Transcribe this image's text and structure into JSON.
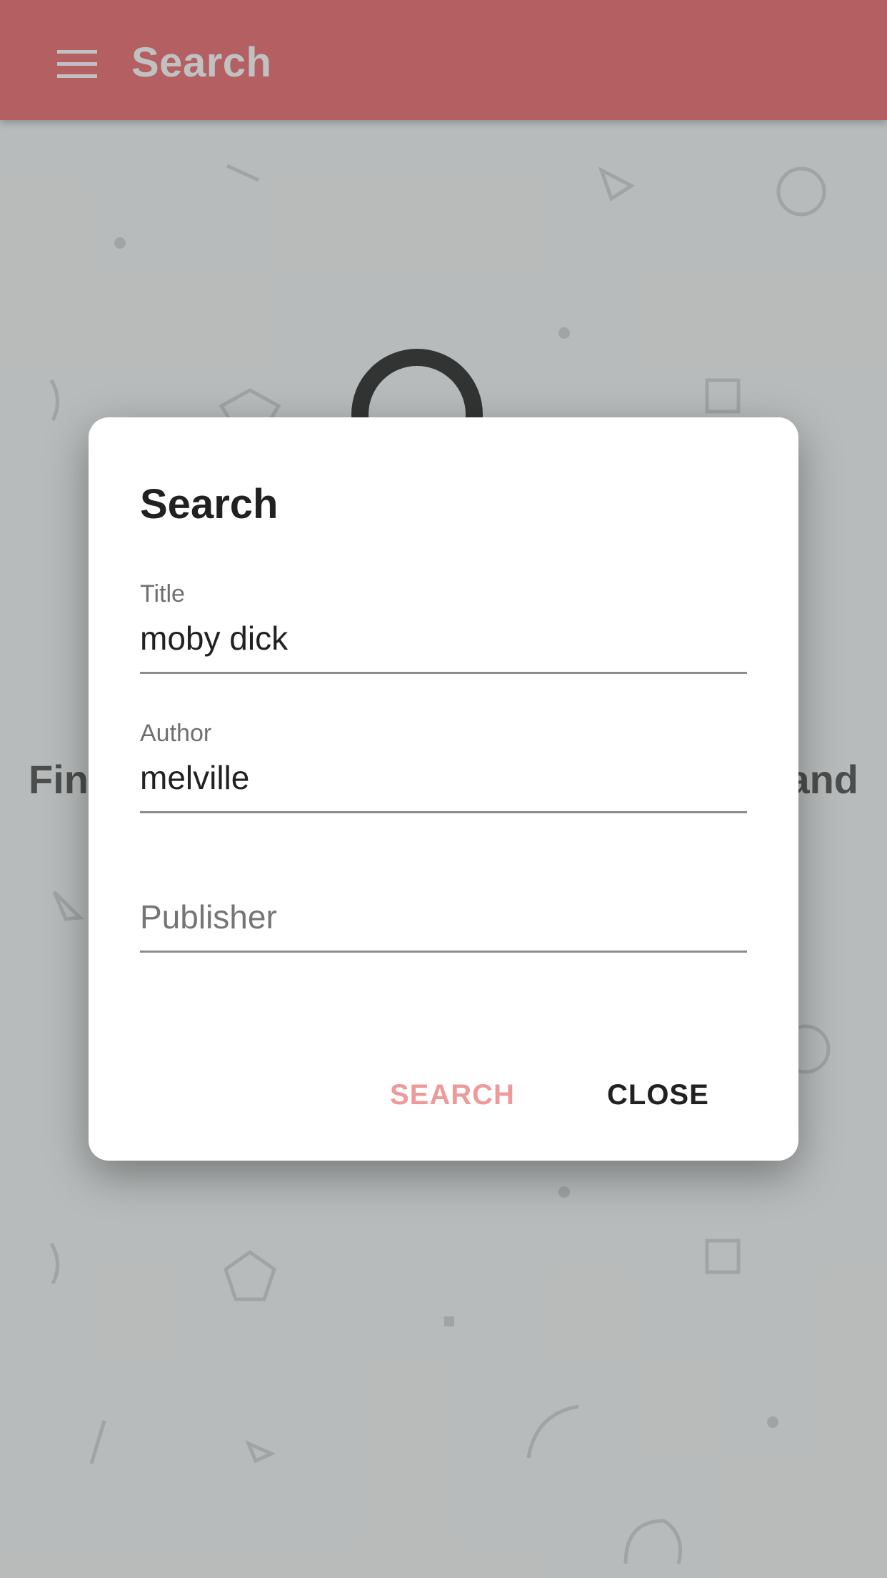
{
  "app_bar": {
    "title": "Search",
    "menu_icon": "hamburger-menu-icon",
    "color": "#ee6f73"
  },
  "background": {
    "icon": "magnifier-icon",
    "intro_left_text": "Fin",
    "intro_right_text": "and"
  },
  "dialog": {
    "title": "Search",
    "fields": {
      "title": {
        "label": "Title",
        "value": "moby dick"
      },
      "author": {
        "label": "Author",
        "value": "melville"
      },
      "publisher": {
        "placeholder": "Publisher"
      }
    },
    "buttons": {
      "search_label": "SEARCH",
      "close_label": "CLOSE"
    },
    "search_button_color": "#ef9a9a"
  }
}
